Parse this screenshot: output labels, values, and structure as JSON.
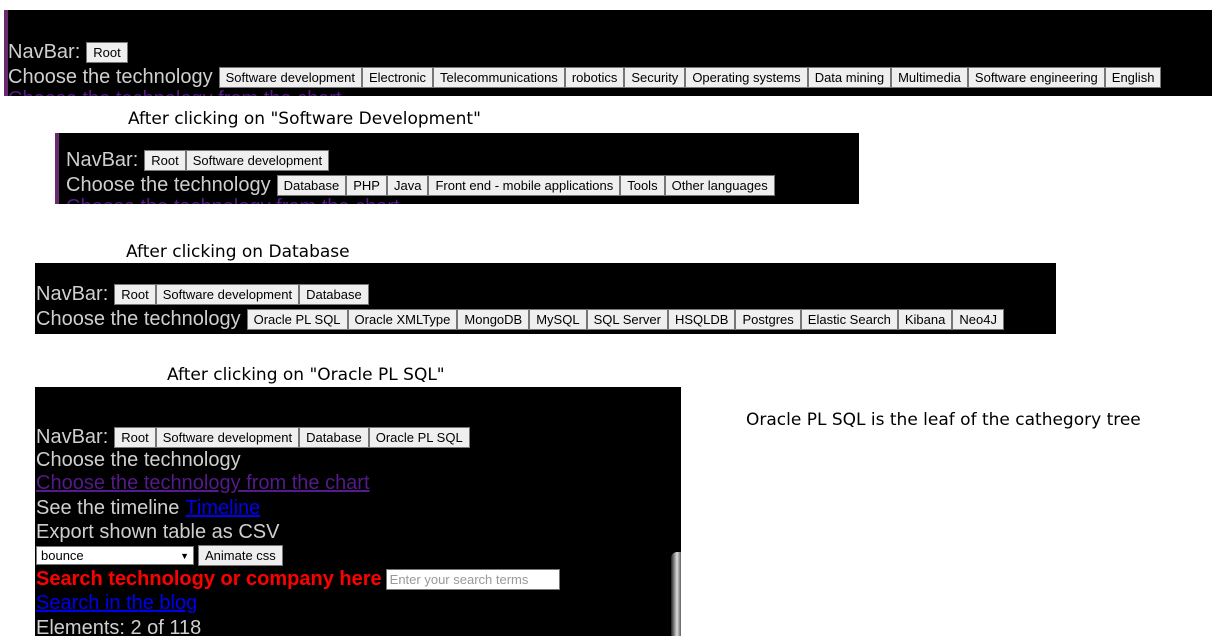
{
  "panel1": {
    "navbar_label": "NavBar:",
    "navbar_items": [
      "Root"
    ],
    "choose_label": "Choose the technology",
    "tech_items": [
      "Software development",
      "Electronic",
      "Telecommunications",
      "robotics",
      "Security",
      "Operating systems",
      "Data mining",
      "Multimedia",
      "Software engineering",
      "English"
    ]
  },
  "caption1": "After clicking on \"Software Development\"",
  "panel2": {
    "navbar_label": "NavBar:",
    "navbar_items": [
      "Root",
      "Software development"
    ],
    "choose_label": "Choose the technology",
    "tech_items": [
      "Database",
      "PHP",
      "Java",
      "Front end - mobile applications",
      "Tools",
      "Other languages"
    ]
  },
  "caption2": "After clicking on Database",
  "panel3": {
    "navbar_label": "NavBar:",
    "navbar_items": [
      "Root",
      "Software development",
      "Database"
    ],
    "choose_label": "Choose the technology",
    "tech_items": [
      "Oracle PL SQL",
      "Oracle XMLType",
      "MongoDB",
      "MySQL",
      "SQL Server",
      "HSQLDB",
      "Postgres",
      "Elastic Search",
      "Kibana",
      "Neo4J"
    ]
  },
  "caption3": "After clicking on \"Oracle PL SQL\"",
  "panel4": {
    "navbar_label": "NavBar:",
    "navbar_items": [
      "Root",
      "Software development",
      "Database",
      "Oracle PL SQL"
    ],
    "choose_label": "Choose the technology",
    "chart_link": "Choose the technology from the chart",
    "timeline_prefix": "See the timeline",
    "timeline_link": "Timeline",
    "export_label": "Export shown table as CSV",
    "animation_select": "bounce",
    "animate_button": "Animate css",
    "search_label": "Search technology or company here",
    "search_placeholder": "Enter your search terms",
    "blog_link": "Search in the blog",
    "elements_label": "Elements: 2 of 118"
  },
  "side_note": "Oracle PL SQL is the leaf of the cathegory tree"
}
